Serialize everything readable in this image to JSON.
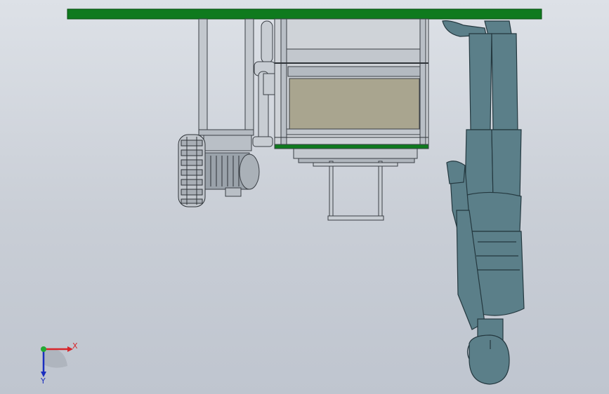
{
  "viewport": {
    "background_top": "#dde1e7",
    "background_bottom": "#bfc5cf",
    "model_parts": [
      "ground-plane",
      "machine-frame",
      "drive-motor",
      "tread-wheel",
      "pipe-assembly",
      "tank-body",
      "ladder",
      "human-figure"
    ]
  },
  "colors": {
    "plane": "#0f7a1e",
    "frame_line": "#3a3f45",
    "metal": "#b9bfc6",
    "panel": "#a9a58f",
    "purple_bracket": "#6d6691",
    "figure": "#5b7f89",
    "figure_edge": "#24383f",
    "motor": "#9aa2aa"
  },
  "triad": {
    "x_label": "X",
    "y_label": "Y",
    "x_color": "#d8262b",
    "y_color": "#1b2fbf",
    "origin_color": "#22aa33"
  }
}
